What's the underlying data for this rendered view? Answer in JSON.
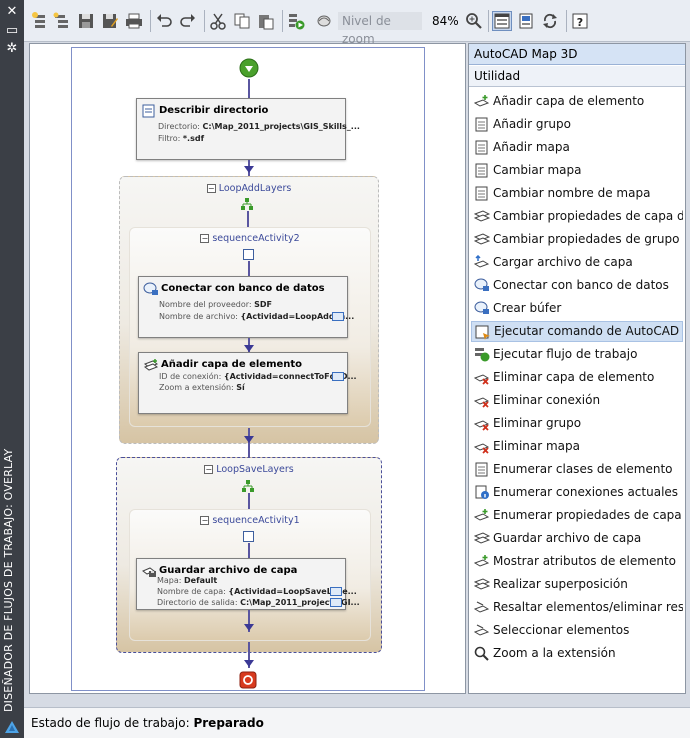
{
  "window": {
    "vertical_title": "DISEÑADOR DE FLUJOS DE TRABAJO: OVERLAY"
  },
  "toolbar": {
    "zoom_placeholder": "Nivel de zoom",
    "zoom_value": "84%"
  },
  "workflow": {
    "activity_describe": {
      "title": "Describir directorio",
      "rows": [
        {
          "label": "Directorio:",
          "value": "C:\\Map_2011_projects\\GIS_Skills_..."
        },
        {
          "label": "Filtro:",
          "value": "*.sdf"
        }
      ]
    },
    "loop_add": {
      "title": "LoopAddLayers",
      "sequence_title": "sequenceActivity2",
      "connect": {
        "title": "Conectar con banco de datos",
        "rows": [
          {
            "label": "Nombre del proveedor:",
            "value": "SDF"
          },
          {
            "label": "Nombre de archivo:",
            "value": "{Actividad=LoopAddLa..."
          }
        ]
      },
      "add_layer": {
        "title": "Añadir capa de elemento",
        "rows": [
          {
            "label": "ID de conexión:",
            "value": "{Actividad=connectToFdoD..."
          },
          {
            "label": "Zoom a extensión:",
            "value": "Sí"
          }
        ]
      }
    },
    "loop_save": {
      "title": "LoopSaveLayers",
      "sequence_title": "sequenceActivity1",
      "save": {
        "title": "Guardar archivo de capa",
        "rows": [
          {
            "label": "Mapa:",
            "value": "Default"
          },
          {
            "label": "Nombre de capa:",
            "value": "{Actividad=LoopSaveLaye..."
          },
          {
            "label": "Directorio de salida:",
            "value": "C:\\Map_2011_projects\\GI..."
          }
        ]
      }
    }
  },
  "panel": {
    "category1": "AutoCAD Map 3D",
    "category2": "Utilidad",
    "items": [
      {
        "label": "Añadir capa de elemento",
        "icon": "add-feature-layer-icon"
      },
      {
        "label": "Añadir grupo",
        "icon": "add-group-icon"
      },
      {
        "label": "Añadir mapa",
        "icon": "add-map-icon"
      },
      {
        "label": "Cambiar mapa",
        "icon": "change-map-icon"
      },
      {
        "label": "Cambiar nombre de mapa",
        "icon": "rename-map-icon"
      },
      {
        "label": "Cambiar propiedades de capa de ele",
        "icon": "layer-properties-icon"
      },
      {
        "label": "Cambiar propiedades de grupo",
        "icon": "group-properties-icon"
      },
      {
        "label": "Cargar archivo de capa",
        "icon": "load-layer-file-icon"
      },
      {
        "label": "Conectar con banco de datos",
        "icon": "connect-datastore-icon"
      },
      {
        "label": "Crear búfer",
        "icon": "buffer-icon"
      },
      {
        "label": "Ejecutar comando de AutoCAD",
        "icon": "run-command-icon"
      },
      {
        "label": "Ejecutar flujo de trabajo",
        "icon": "run-workflow-icon"
      },
      {
        "label": "Eliminar capa de elemento",
        "icon": "remove-layer-icon"
      },
      {
        "label": "Eliminar conexión",
        "icon": "remove-connection-icon"
      },
      {
        "label": "Eliminar grupo",
        "icon": "remove-group-icon"
      },
      {
        "label": "Eliminar mapa",
        "icon": "remove-map-icon"
      },
      {
        "label": "Enumerar clases de elemento",
        "icon": "list-classes-icon"
      },
      {
        "label": "Enumerar conexiones actuales",
        "icon": "list-connections-icon"
      },
      {
        "label": "Enumerar propiedades de capa de el",
        "icon": "list-layer-properties-icon"
      },
      {
        "label": "Guardar archivo de capa",
        "icon": "save-layer-file-icon"
      },
      {
        "label": "Mostrar atributos de elemento",
        "icon": "show-attributes-icon"
      },
      {
        "label": "Realizar superposición",
        "icon": "overlay-icon"
      },
      {
        "label": "Resaltar elementos/eliminar resaltad",
        "icon": "highlight-icon"
      },
      {
        "label": "Seleccionar elementos",
        "icon": "select-features-icon"
      },
      {
        "label": "Zoom a la extensión",
        "icon": "zoom-extents-icon"
      }
    ],
    "highlighted_index": 10
  },
  "status": {
    "label": "Estado de flujo de trabajo:",
    "value": "Preparado"
  },
  "colors": {
    "highlight": "#cfdff3",
    "connector": "#3b3995",
    "start": "#4aa02c",
    "end": "#d83a1e"
  }
}
